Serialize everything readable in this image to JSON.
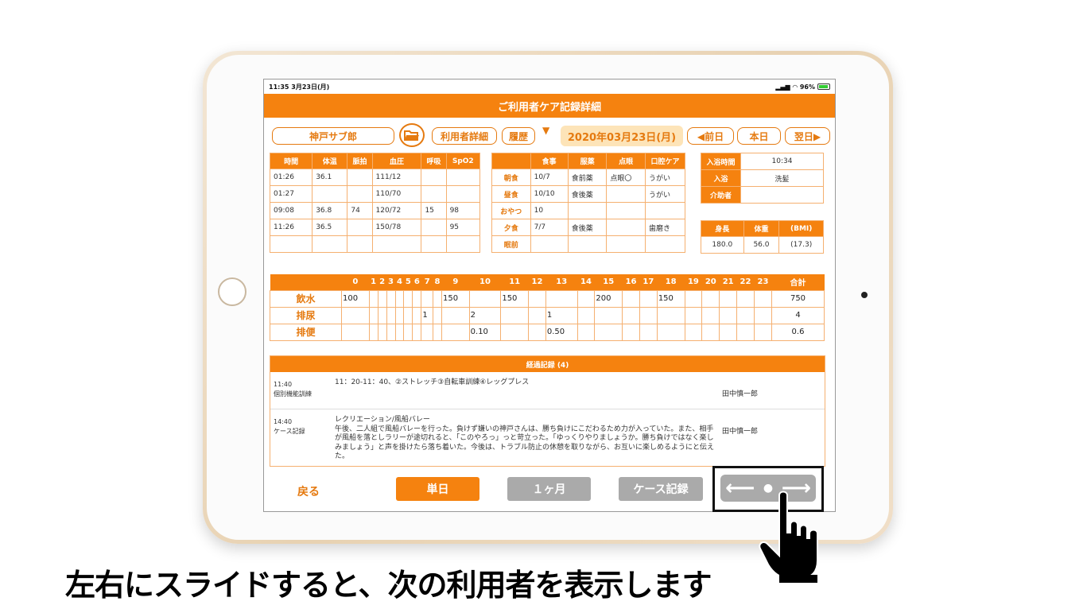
{
  "status": {
    "time_date": "11:35 3月23日(月)",
    "battery": "96%"
  },
  "header": {
    "title": "ご利用者ケア記録詳細"
  },
  "toolbar": {
    "user_name": "神戸サブ郎",
    "user_detail": "利用者詳細",
    "history": "履歴",
    "dropdown": "▼",
    "date": "2020年03月23日(月)",
    "prev_day": "◀前日",
    "today": "本日",
    "next_day": "翌日▶"
  },
  "vitals": {
    "headers": [
      "時間",
      "体温",
      "脈拍",
      "血圧",
      "呼吸",
      "SpO2"
    ],
    "rows": [
      [
        "01:26",
        "36.1",
        "",
        "111/12",
        "",
        ""
      ],
      [
        "01:27",
        "",
        "",
        "110/70",
        "",
        ""
      ],
      [
        "09:08",
        "36.8",
        "74",
        "120/72",
        "15",
        "98"
      ],
      [
        "11:26",
        "36.5",
        "",
        "150/78",
        "",
        "95"
      ],
      [
        "",
        "",
        "",
        "",
        "",
        ""
      ]
    ]
  },
  "meals": {
    "headers": [
      "",
      "食事",
      "服薬",
      "点眼",
      "口腔ケア"
    ],
    "rows": [
      [
        "朝食",
        "10/7",
        "食前薬",
        "点眼〇",
        "うがい"
      ],
      [
        "昼食",
        "10/10",
        "食後薬",
        "",
        "うがい"
      ],
      [
        "おやつ",
        "10",
        "",
        "",
        ""
      ],
      [
        "夕食",
        "7/7",
        "食後薬",
        "",
        "歯磨き"
      ],
      [
        "眠前",
        "",
        "",
        "",
        ""
      ]
    ]
  },
  "bath": {
    "rows": [
      [
        "入浴時間",
        "10:34"
      ],
      [
        "入浴",
        "洗髪"
      ],
      [
        "介助者",
        ""
      ]
    ]
  },
  "body": {
    "headers": [
      "身長",
      "体重",
      "(BMI)"
    ],
    "values": [
      "180.0",
      "56.0",
      "(17.3)"
    ]
  },
  "hourly": {
    "hours": [
      "0",
      "1",
      "2",
      "3",
      "4",
      "5",
      "6",
      "7",
      "8",
      "9",
      "10",
      "11",
      "12",
      "13",
      "14",
      "15",
      "16",
      "17",
      "18",
      "19",
      "20",
      "21",
      "22",
      "23"
    ],
    "total_label": "合計",
    "rows": [
      {
        "label": "飲水",
        "cells": [
          "100",
          "",
          "",
          "",
          "",
          "",
          "",
          "",
          "",
          "150",
          "",
          "150",
          "",
          "",
          "",
          "200",
          "",
          "",
          "150",
          "",
          "",
          "",
          "",
          ""
        ],
        "total": "750"
      },
      {
        "label": "排尿",
        "cells": [
          "",
          "",
          "",
          "",
          "",
          "",
          "",
          "1",
          "",
          "",
          "2",
          "",
          "",
          "1",
          "",
          "",
          "",
          "",
          "",
          "",
          "",
          "",
          "",
          ""
        ],
        "total": "4"
      },
      {
        "label": "排便",
        "cells": [
          "",
          "",
          "",
          "",
          "",
          "",
          "",
          "",
          "",
          "",
          "0.10",
          "",
          "",
          "0.50",
          "",
          "",
          "",
          "",
          "",
          "",
          "",
          "",
          "",
          ""
        ],
        "total": "0.6"
      }
    ]
  },
  "log": {
    "title": "経過記録 (4)",
    "entries": [
      {
        "time": "11:40",
        "type": "個別機能訓練",
        "text": "11：20-11：40、②ストレッチ③自転車訓練④レッグプレス",
        "staff": "田中慎一郎"
      },
      {
        "time": "14:40",
        "type": "ケース記録",
        "text": "レクリエーション/風船バレー\n午後、二人組で風船バレーを行った。負けず嫌いの神戸さんは、勝ち負けにこだわるため力が入っていた。また、相手が風船を落としラリーが途切れると、「このやろっ」っと苛立った。「ゆっくりやりましょうか。勝ち負けではなく楽しみましょう」と声を掛けたら落ち着いた。今後は、トラブル防止の休憩を取りながら、お互いに楽しめるようにと伝えた。",
        "staff": "田中慎一郎"
      }
    ]
  },
  "bottom": {
    "back": "戻る",
    "single_day": "単日",
    "one_month": "１ヶ月",
    "case_record": "ケース記録",
    "swipe_left": "⟵",
    "swipe_right": "⟶"
  },
  "colors": {
    "accent": "#f5820f",
    "inactive": "#aaaaaa",
    "date_bg": "#fde4b8"
  },
  "caption": "左右にスライドすると、次の利用者を表示します"
}
